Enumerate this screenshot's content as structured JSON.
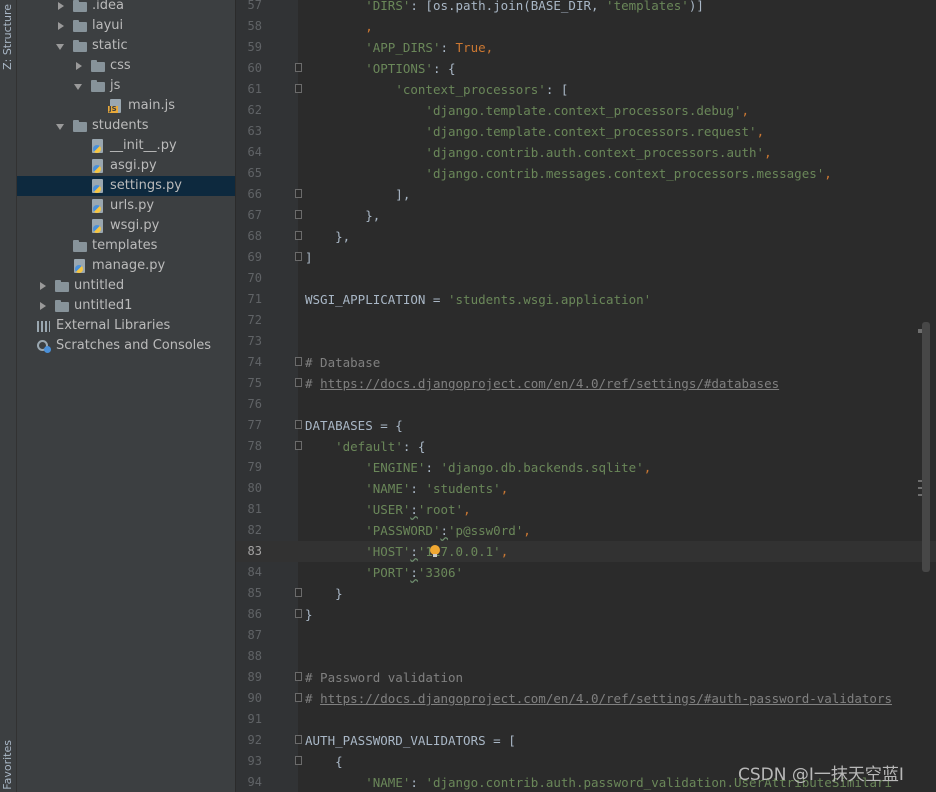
{
  "left_strip": {
    "structure_label": "Z: Structure",
    "favorites_label": "Favorites"
  },
  "project_tree": [
    {
      "label": ".idea",
      "icon": "folder-icon",
      "arrow": "right"
    },
    {
      "label": "layui",
      "icon": "folder-icon",
      "arrow": "right"
    },
    {
      "label": "static",
      "icon": "folder-icon",
      "arrow": "down"
    },
    {
      "label": "css",
      "icon": "folder-icon",
      "arrow": "right"
    },
    {
      "label": "js",
      "icon": "folder-icon",
      "arrow": "down"
    },
    {
      "label": "main.js",
      "icon": "js-file-icon",
      "arrow": ""
    },
    {
      "label": "students",
      "icon": "folder-icon",
      "arrow": "down"
    },
    {
      "label": "__init__.py",
      "icon": "python-file-icon",
      "arrow": ""
    },
    {
      "label": "asgi.py",
      "icon": "python-file-icon",
      "arrow": ""
    },
    {
      "label": "settings.py",
      "icon": "python-file-icon",
      "arrow": "",
      "selected": true
    },
    {
      "label": "urls.py",
      "icon": "python-file-icon",
      "arrow": ""
    },
    {
      "label": "wsgi.py",
      "icon": "python-file-icon",
      "arrow": ""
    },
    {
      "label": "templates",
      "icon": "folder-icon",
      "arrow": ""
    },
    {
      "label": "manage.py",
      "icon": "python-file-icon",
      "arrow": ""
    },
    {
      "label": "untitled",
      "icon": "folder-icon",
      "arrow": "right"
    },
    {
      "label": "untitled1",
      "icon": "folder-icon",
      "arrow": "right"
    },
    {
      "label": "External Libraries",
      "icon": "libraries-icon",
      "arrow": ""
    },
    {
      "label": "Scratches and Consoles",
      "icon": "scratches-icon",
      "arrow": ""
    }
  ],
  "editor": {
    "current_line": 83,
    "lines": [
      {
        "n": "57",
        "fold": false,
        "tokens": [
          [
            "        ",
            "p"
          ],
          [
            "'DIRS'",
            "s"
          ],
          [
            ": [os.path.join(BASE_DIR, ",
            "p"
          ],
          [
            "'templates'",
            "s"
          ],
          [
            ")]",
            "p"
          ]
        ]
      },
      {
        "n": "58",
        "fold": false,
        "tokens": [
          [
            "        ",
            "p"
          ],
          [
            ",",
            "k"
          ]
        ]
      },
      {
        "n": "59",
        "fold": false,
        "tokens": [
          [
            "        ",
            "p"
          ],
          [
            "'APP_DIRS'",
            "s"
          ],
          [
            ": ",
            "p"
          ],
          [
            "True",
            "k"
          ],
          [
            ",",
            "k"
          ]
        ]
      },
      {
        "n": "60",
        "fold": true,
        "tokens": [
          [
            "        ",
            "p"
          ],
          [
            "'OPTIONS'",
            "s"
          ],
          [
            ": {",
            "p"
          ]
        ]
      },
      {
        "n": "61",
        "fold": true,
        "tokens": [
          [
            "            ",
            "p"
          ],
          [
            "'context_processors'",
            "s"
          ],
          [
            ": [",
            "p"
          ]
        ]
      },
      {
        "n": "62",
        "fold": false,
        "tokens": [
          [
            "                ",
            "p"
          ],
          [
            "'django.template.context_processors.debug'",
            "s"
          ],
          [
            ",",
            "k"
          ]
        ]
      },
      {
        "n": "63",
        "fold": false,
        "tokens": [
          [
            "                ",
            "p"
          ],
          [
            "'django.template.context_processors.request'",
            "s"
          ],
          [
            ",",
            "k"
          ]
        ]
      },
      {
        "n": "64",
        "fold": false,
        "tokens": [
          [
            "                ",
            "p"
          ],
          [
            "'django.contrib.auth.context_processors.auth'",
            "s"
          ],
          [
            ",",
            "k"
          ]
        ]
      },
      {
        "n": "65",
        "fold": false,
        "tokens": [
          [
            "                ",
            "p"
          ],
          [
            "'django.contrib.messages.context_processors.messages'",
            "s"
          ],
          [
            ",",
            "k"
          ]
        ]
      },
      {
        "n": "66",
        "fold": true,
        "tokens": [
          [
            "            ],",
            "p"
          ]
        ]
      },
      {
        "n": "67",
        "fold": true,
        "tokens": [
          [
            "        },",
            "p"
          ]
        ]
      },
      {
        "n": "68",
        "fold": true,
        "tokens": [
          [
            "    },",
            "p"
          ]
        ]
      },
      {
        "n": "69",
        "fold": true,
        "tokens": [
          [
            "]",
            "p"
          ]
        ]
      },
      {
        "n": "70",
        "fold": false,
        "tokens": []
      },
      {
        "n": "71",
        "fold": false,
        "tokens": [
          [
            "WSGI_APPLICATION = ",
            "p"
          ],
          [
            "'students.wsgi.application'",
            "s"
          ]
        ]
      },
      {
        "n": "72",
        "fold": false,
        "tokens": []
      },
      {
        "n": "73",
        "fold": false,
        "tokens": []
      },
      {
        "n": "74",
        "fold": true,
        "tokens": [
          [
            "# Database",
            "c"
          ]
        ]
      },
      {
        "n": "75",
        "fold": true,
        "tokens": [
          [
            "# ",
            "c"
          ],
          [
            "https://docs.djangoproject.com/en/4.0/ref/settings/#databases",
            "l"
          ]
        ]
      },
      {
        "n": "76",
        "fold": false,
        "tokens": []
      },
      {
        "n": "77",
        "fold": true,
        "tokens": [
          [
            "DATABASES = {",
            "p"
          ]
        ]
      },
      {
        "n": "78",
        "fold": true,
        "tokens": [
          [
            "    ",
            "p"
          ],
          [
            "'default'",
            "s"
          ],
          [
            ": {",
            "p"
          ]
        ]
      },
      {
        "n": "79",
        "fold": false,
        "tokens": [
          [
            "        ",
            "p"
          ],
          [
            "'ENGINE'",
            "s"
          ],
          [
            ": ",
            "p"
          ],
          [
            "'django.db.backends.sqlite'",
            "s"
          ],
          [
            ",",
            "k"
          ]
        ]
      },
      {
        "n": "80",
        "fold": false,
        "tokens": [
          [
            "        ",
            "p"
          ],
          [
            "'NAME'",
            "s"
          ],
          [
            ": ",
            "p"
          ],
          [
            "'students'",
            "s"
          ],
          [
            ",",
            "k"
          ]
        ]
      },
      {
        "n": "81",
        "fold": false,
        "tokens": [
          [
            "        ",
            "p"
          ],
          [
            "'USER'",
            "s"
          ],
          [
            ":",
            "w"
          ],
          [
            "'root'",
            "s"
          ],
          [
            ",",
            "k"
          ]
        ]
      },
      {
        "n": "82",
        "fold": false,
        "tokens": [
          [
            "        ",
            "p"
          ],
          [
            "'PASSWORD'",
            "s"
          ],
          [
            ":",
            "w"
          ],
          [
            "'p@ssw0rd'",
            "s"
          ],
          [
            ",",
            "k"
          ]
        ]
      },
      {
        "n": "83",
        "fold": false,
        "bulb": true,
        "tokens": [
          [
            "        ",
            "p"
          ],
          [
            "'HOST'",
            "s"
          ],
          [
            ":",
            "w"
          ],
          [
            "'127.0.0.1'",
            "s"
          ],
          [
            ",",
            "k"
          ]
        ]
      },
      {
        "n": "84",
        "fold": false,
        "tokens": [
          [
            "        ",
            "p"
          ],
          [
            "'PORT'",
            "s"
          ],
          [
            ":",
            "w"
          ],
          [
            "'3306'",
            "s"
          ]
        ]
      },
      {
        "n": "85",
        "fold": true,
        "tokens": [
          [
            "    }",
            "p"
          ]
        ]
      },
      {
        "n": "86",
        "fold": true,
        "tokens": [
          [
            "}",
            "p"
          ]
        ]
      },
      {
        "n": "87",
        "fold": false,
        "tokens": []
      },
      {
        "n": "88",
        "fold": false,
        "tokens": []
      },
      {
        "n": "89",
        "fold": true,
        "tokens": [
          [
            "# Password validation",
            "c"
          ]
        ]
      },
      {
        "n": "90",
        "fold": true,
        "tokens": [
          [
            "# ",
            "c"
          ],
          [
            "https://docs.djangoproject.com/en/4.0/ref/settings/#auth-password-validators",
            "l"
          ]
        ]
      },
      {
        "n": "91",
        "fold": false,
        "tokens": []
      },
      {
        "n": "92",
        "fold": true,
        "tokens": [
          [
            "AUTH_PASSWORD_VALIDATORS = [",
            "p"
          ]
        ]
      },
      {
        "n": "93",
        "fold": true,
        "tokens": [
          [
            "    {",
            "p"
          ]
        ]
      },
      {
        "n": "94",
        "fold": false,
        "tokens": [
          [
            "        ",
            "p"
          ],
          [
            "'NAME'",
            "s"
          ],
          [
            ": ",
            "p"
          ],
          [
            "'django.contrib.auth.password_validation.UserAttributeSimilari",
            "s"
          ]
        ]
      }
    ]
  },
  "watermark": "CSDN @I一抹天空蓝I"
}
